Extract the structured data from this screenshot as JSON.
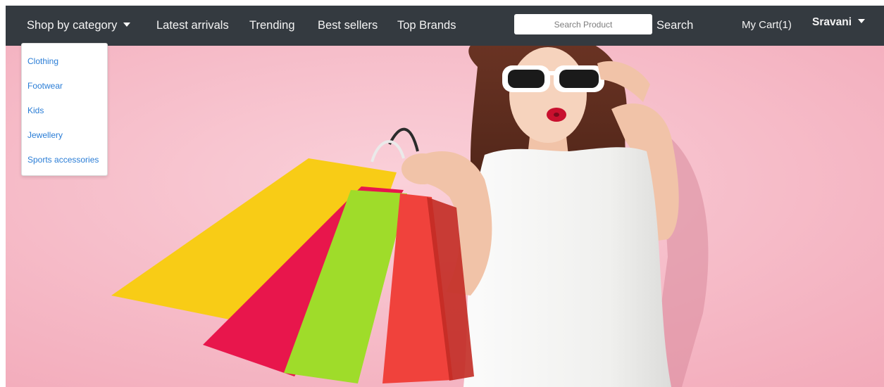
{
  "navbar": {
    "shop_by_category": "Shop by category",
    "latest_arrivals": "Latest arrivals",
    "trending": "Trending",
    "best_sellers": "Best sellers",
    "top_brands": "Top Brands",
    "search": {
      "placeholder": "Search Product",
      "value": "",
      "button_label": "Search"
    },
    "cart_label": "My Cart(1)",
    "user_name": "Sravani"
  },
  "category_menu": {
    "items": [
      {
        "label": "Clothing"
      },
      {
        "label": "Footwear"
      },
      {
        "label": "Kids"
      },
      {
        "label": "Jewellery"
      },
      {
        "label": "Sports accessories"
      }
    ]
  },
  "hero": {
    "image": "shopping-woman-with-colorful-bags",
    "background_color": "#f7bcc8"
  },
  "colors": {
    "navbar_bg": "#343a40",
    "link_blue": "#2a7dd6",
    "bag_yellow": "#f8cc16",
    "bag_crimson": "#e8164c",
    "bag_lime": "#9fdc2a",
    "bag_red": "#f0423c"
  }
}
